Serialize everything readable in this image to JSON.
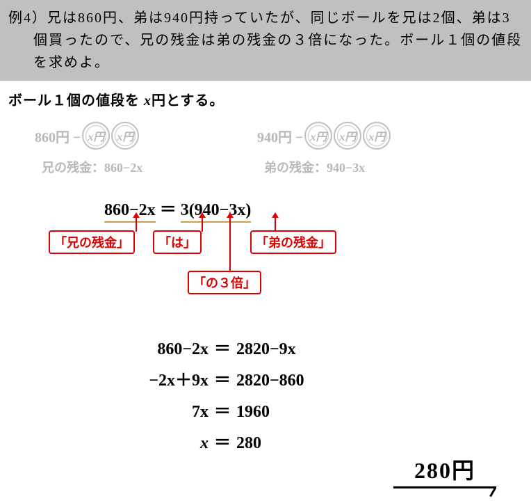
{
  "problem": {
    "label": "例4）",
    "text": "兄は860円、弟は940円持っていたが、同じボールを兄は2個、弟は3個買ったので、兄の残金は弟の残金の３倍になった。ボール１個の値段を求めよ。"
  },
  "setup": {
    "prefix": "ボール１個の値段を ",
    "var": "x",
    "suffix": "円とする。"
  },
  "hint": {
    "ani_money": "860円 −",
    "oto_money": "940円 −",
    "ball_label": "x円",
    "ani_zan": "兄の残金：860−2x",
    "oto_zan": "弟の残金：940−3x"
  },
  "main_equation": {
    "left": "860−2x",
    "eq": "＝",
    "coef": "3",
    "right": "(940−3x)"
  },
  "annotations": {
    "ani": "「兄の残金」",
    "wa": "「は」",
    "oto": "「弟の残金」",
    "bai": "「の３倍」"
  },
  "calc": [
    {
      "left": "860−2x",
      "right": "2820−9x"
    },
    {
      "left": "−2x＋9x",
      "right": "2820−860"
    },
    {
      "left": "7x",
      "right": "1960"
    },
    {
      "left": "x",
      "right": "280"
    }
  ],
  "answer": "280円"
}
